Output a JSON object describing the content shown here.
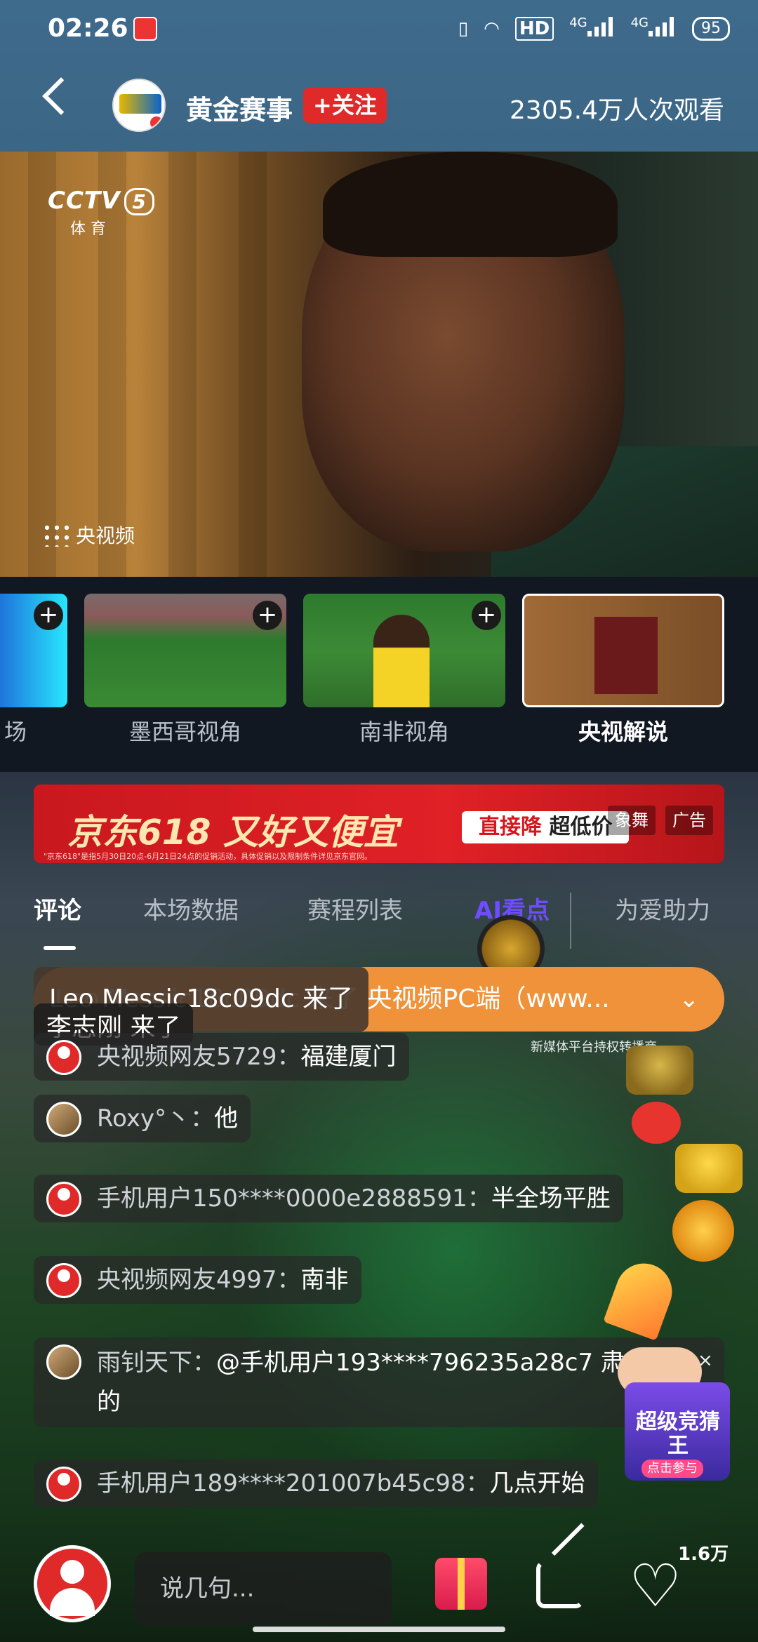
{
  "status_bar": {
    "time": "02:26",
    "hd": "HD",
    "net1": "4G",
    "net2": "4G",
    "battery": "95"
  },
  "header": {
    "channel_name": "黄金赛事",
    "follow_label": "+关注",
    "viewers": "2305.4万人次观看"
  },
  "video": {
    "channel_logo": "CCTV",
    "channel_number": "5",
    "channel_sub": "体 育",
    "watermark": "央视频"
  },
  "angles": [
    {
      "label": "场",
      "active": false
    },
    {
      "label": "墨西哥视角",
      "active": false
    },
    {
      "label": "南非视角",
      "active": false
    },
    {
      "label": "央视解说",
      "active": true
    }
  ],
  "ad": {
    "title": "京东618 又好又便宜",
    "button": "直接降",
    "button2": "超低价",
    "tag1": "象舞",
    "tag2": "广告",
    "fine_print": "\"京东618\"是指5月30日20点-6月21日24点的促销活动，具体促销以及限制条件详见京东官网。"
  },
  "tabs": [
    {
      "label": "评论",
      "active": true
    },
    {
      "label": "本场数据",
      "active": false
    },
    {
      "label": "赛程列表",
      "active": false
    },
    {
      "label": "AI看点",
      "active": false
    },
    {
      "label": "为爱助力",
      "active": false
    }
  ],
  "banner": {
    "text": "Leo Messic18c09dc 来了  央视频PC端（www...",
    "join1": "Leo Messic18c09dc 来了",
    "join2": "李志刚 来了",
    "sponsor_caption": "新媒体平台持权转播商"
  },
  "comments": [
    {
      "name": "央视频网友5729：",
      "text": "福建厦门"
    },
    {
      "name": "Roxy°丶：",
      "text": "他"
    },
    {
      "name": "手机用户150****0000e2888591：",
      "text": "半全场平胜"
    },
    {
      "name": "央视频网友4997：",
      "text": "南非"
    },
    {
      "name": "雨钊天下：",
      "text": "@手机用户193****796235a28c7 肃",
      "text2": "的"
    },
    {
      "name": "手机用户189****201007b45c98：",
      "text": "几点开始"
    }
  ],
  "promo": {
    "title": "超级竞猜王",
    "sub": "点击参与"
  },
  "bottom": {
    "input_placeholder": "说几句...",
    "likes": "1.6万"
  }
}
